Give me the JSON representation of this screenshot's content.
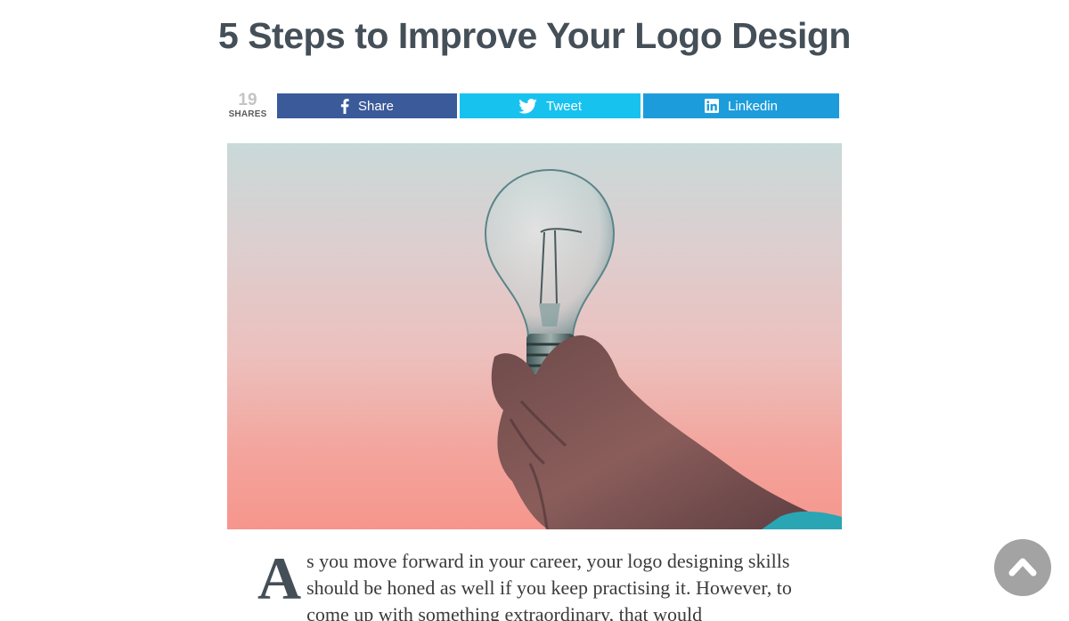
{
  "article": {
    "title": "5 Steps to Improve Your Logo Design",
    "dropcap": "A",
    "body_text": "s you move forward in your career, your logo designing skills should be honed as well if you keep practising it. However, to come up with something extraordinary, that would"
  },
  "share": {
    "count": "19",
    "count_label": "SHARES",
    "buttons": [
      {
        "label": "Share",
        "icon": "facebook-icon",
        "color": "#3b5a9a"
      },
      {
        "label": "Tweet",
        "icon": "twitter-icon",
        "color": "#18c2ef"
      },
      {
        "label": "Linkedin",
        "icon": "linkedin-icon",
        "color": "#1d9cdc"
      }
    ]
  },
  "hero_image": {
    "subject": "hand-holding-light-bulb",
    "colors": {
      "sky_top": "#c9d9d9",
      "sky_bottom": "#f6968d"
    }
  },
  "scroll_top": {
    "icon": "chevron-up-icon",
    "color": "#a3a3a3"
  }
}
